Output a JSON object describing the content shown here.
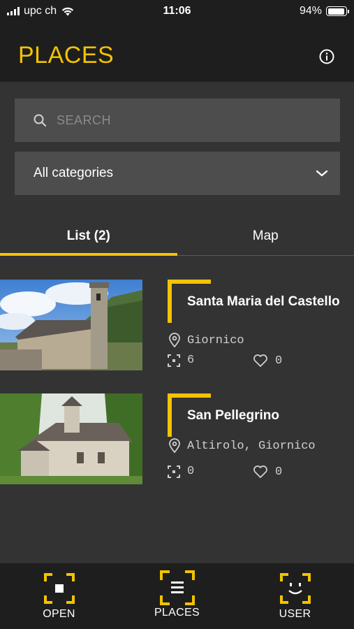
{
  "status_bar": {
    "carrier": "upc ch",
    "time": "11:06",
    "battery": "94%",
    "battery_level": 0.94,
    "signal_bars": 4
  },
  "header": {
    "title": "PLACES",
    "info_icon": "info-circle-icon"
  },
  "search": {
    "placeholder": "SEARCH",
    "value": "",
    "icon": "search-icon"
  },
  "category_filter": {
    "selected": "All categories",
    "icon": "chevron-down-icon"
  },
  "tabs": [
    {
      "label": "List (2)",
      "active": true
    },
    {
      "label": "Map",
      "active": false
    }
  ],
  "places": [
    {
      "name": "Santa Maria del Castello",
      "location": "Giornico",
      "scans": "6",
      "likes": "0"
    },
    {
      "name": "San Pellegrino",
      "location": "Altirolo, Giornico",
      "scans": "0",
      "likes": "0"
    }
  ],
  "bottom_nav": [
    {
      "label": "OPEN",
      "icon": "scan-open-icon"
    },
    {
      "label": "PLACES",
      "icon": "scan-list-icon"
    },
    {
      "label": "USER",
      "icon": "scan-face-icon"
    }
  ],
  "colors": {
    "accent": "#f2c300",
    "background": "#333333",
    "header": "#1e1e1e",
    "field": "#4d4d4d"
  }
}
